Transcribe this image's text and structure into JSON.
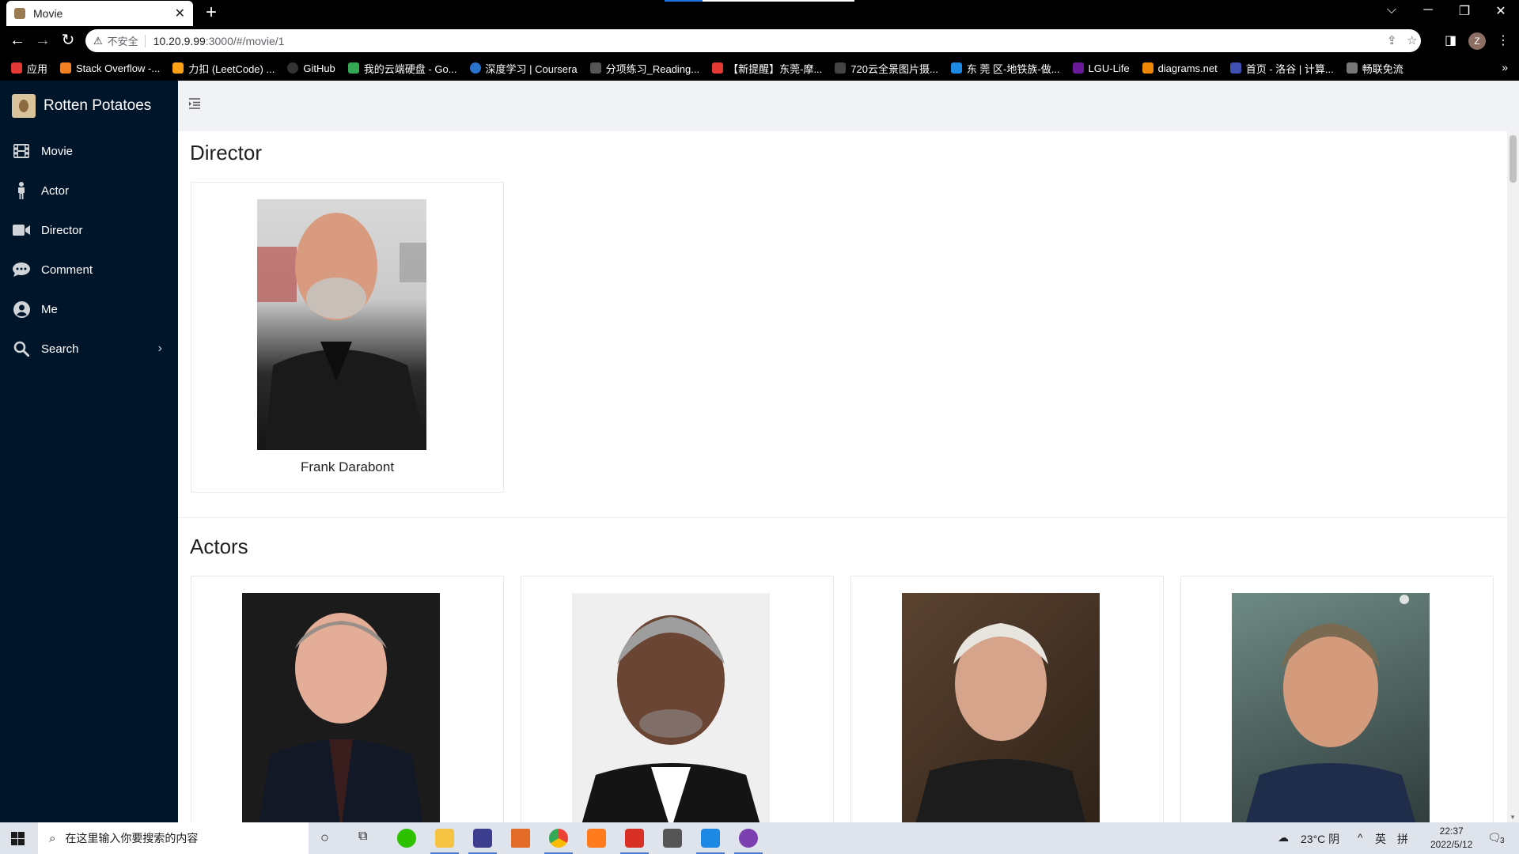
{
  "browser": {
    "tab_title": "Movie",
    "new_tab": "+",
    "insecure_label": "不安全",
    "url_host": "10.20.9.99",
    "url_path": ":3000/#/movie/1",
    "profile_initial": "Z",
    "bookmarks": [
      {
        "label": "应用",
        "color": "#f4b400"
      },
      {
        "label": "Stack Overflow -...",
        "color": "#f48024"
      },
      {
        "label": "力扣 (LeetCode) ...",
        "color": "#ffa116"
      },
      {
        "label": "GitHub",
        "color": "#333333"
      },
      {
        "label": "我的云端硬盘 - Go...",
        "color": "#34a853"
      },
      {
        "label": "深度学习 | Coursera",
        "color": "#2a73cc"
      },
      {
        "label": "分项练习_Reading...",
        "color": "#555555"
      },
      {
        "label": "【新提醒】东莞-摩...",
        "color": "#e53935"
      },
      {
        "label": "720云全景图片摄...",
        "color": "#444444"
      },
      {
        "label": "东 莞 区-地铁族-做...",
        "color": "#1e88e5"
      },
      {
        "label": "LGU-Life",
        "color": "#6a1b9a"
      },
      {
        "label": "diagrams.net",
        "color": "#f08705"
      },
      {
        "label": "首页 - 洛谷 | 计算...",
        "color": "#3f51b5"
      },
      {
        "label": "畅联免流",
        "color": "#777777"
      }
    ],
    "more": "»"
  },
  "sidebar": {
    "brand": "Rotten Potatoes",
    "items": [
      {
        "label": "Movie",
        "icon": "film-icon"
      },
      {
        "label": "Actor",
        "icon": "person-icon"
      },
      {
        "label": "Director",
        "icon": "video-camera-icon"
      },
      {
        "label": "Comment",
        "icon": "comment-icon"
      },
      {
        "label": "Me",
        "icon": "user-circle-icon"
      },
      {
        "label": "Search",
        "icon": "search-icon"
      }
    ],
    "search_chevron": "›"
  },
  "main": {
    "director_section": {
      "title": "Director",
      "name": "Frank Darabont"
    },
    "actors_section": {
      "title": "Actors"
    }
  },
  "taskbar": {
    "search_placeholder": "在这里输入你要搜索的内容",
    "weather": "23°C 阴",
    "ime_lang": "英",
    "ime_mode": "拼",
    "time": "22:37",
    "date": "2022/5/12",
    "notifications": "3"
  },
  "colors": {
    "sidebar_bg": "#001529",
    "header_bg": "#f0f2f5",
    "taskbar_bg": "#dfe4ec"
  }
}
